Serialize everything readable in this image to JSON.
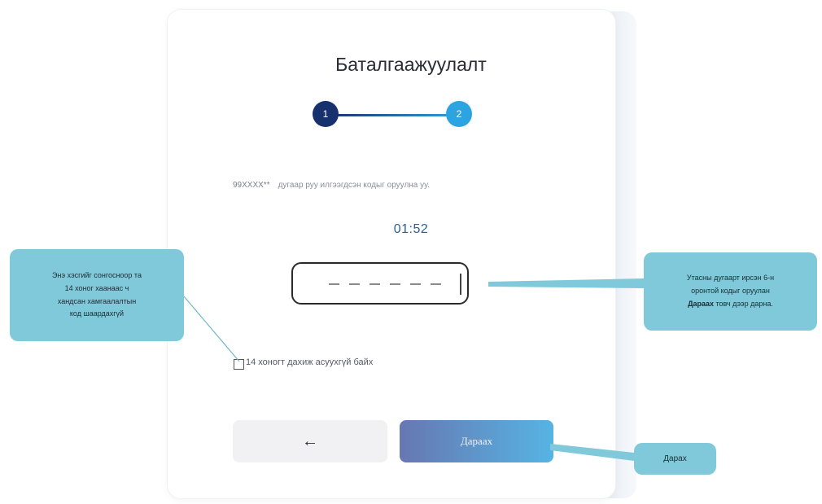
{
  "page": {
    "title": "Баталгаажуулалт",
    "steps": [
      "1",
      "2"
    ],
    "instruction": {
      "masked_number": "99XXXX**",
      "text": "дугаар руу илгээгдсэн кодыг оруулна уу."
    },
    "timer": "01:52",
    "code_input": {
      "placeholder": "_ _ _ _ _ _"
    },
    "remember": {
      "checked": false,
      "label": "14 хоногт дахиж асуухгүй байх"
    },
    "buttons": {
      "back": "←",
      "next": "Дараах"
    }
  },
  "callouts": {
    "left": [
      "Энэ хэсгийг сонгосноор та",
      "14 хоног хаанаас ч",
      "хандсан хамгаалалтын",
      "код шаардахгүй"
    ],
    "right": {
      "line1": "Утасны дугаарт ирсэн 6-н",
      "line2": "оронтой кодыг оруулан",
      "bold": "Дараах",
      "line3_rest": " товч дээр дарна."
    },
    "bottom": "Дарах"
  },
  "colors": {
    "step1": "#17316f",
    "step2": "#2ba4e1",
    "callout": "#80c9da",
    "next_gradient": [
      "#6777b2",
      "#56b4e3"
    ]
  }
}
